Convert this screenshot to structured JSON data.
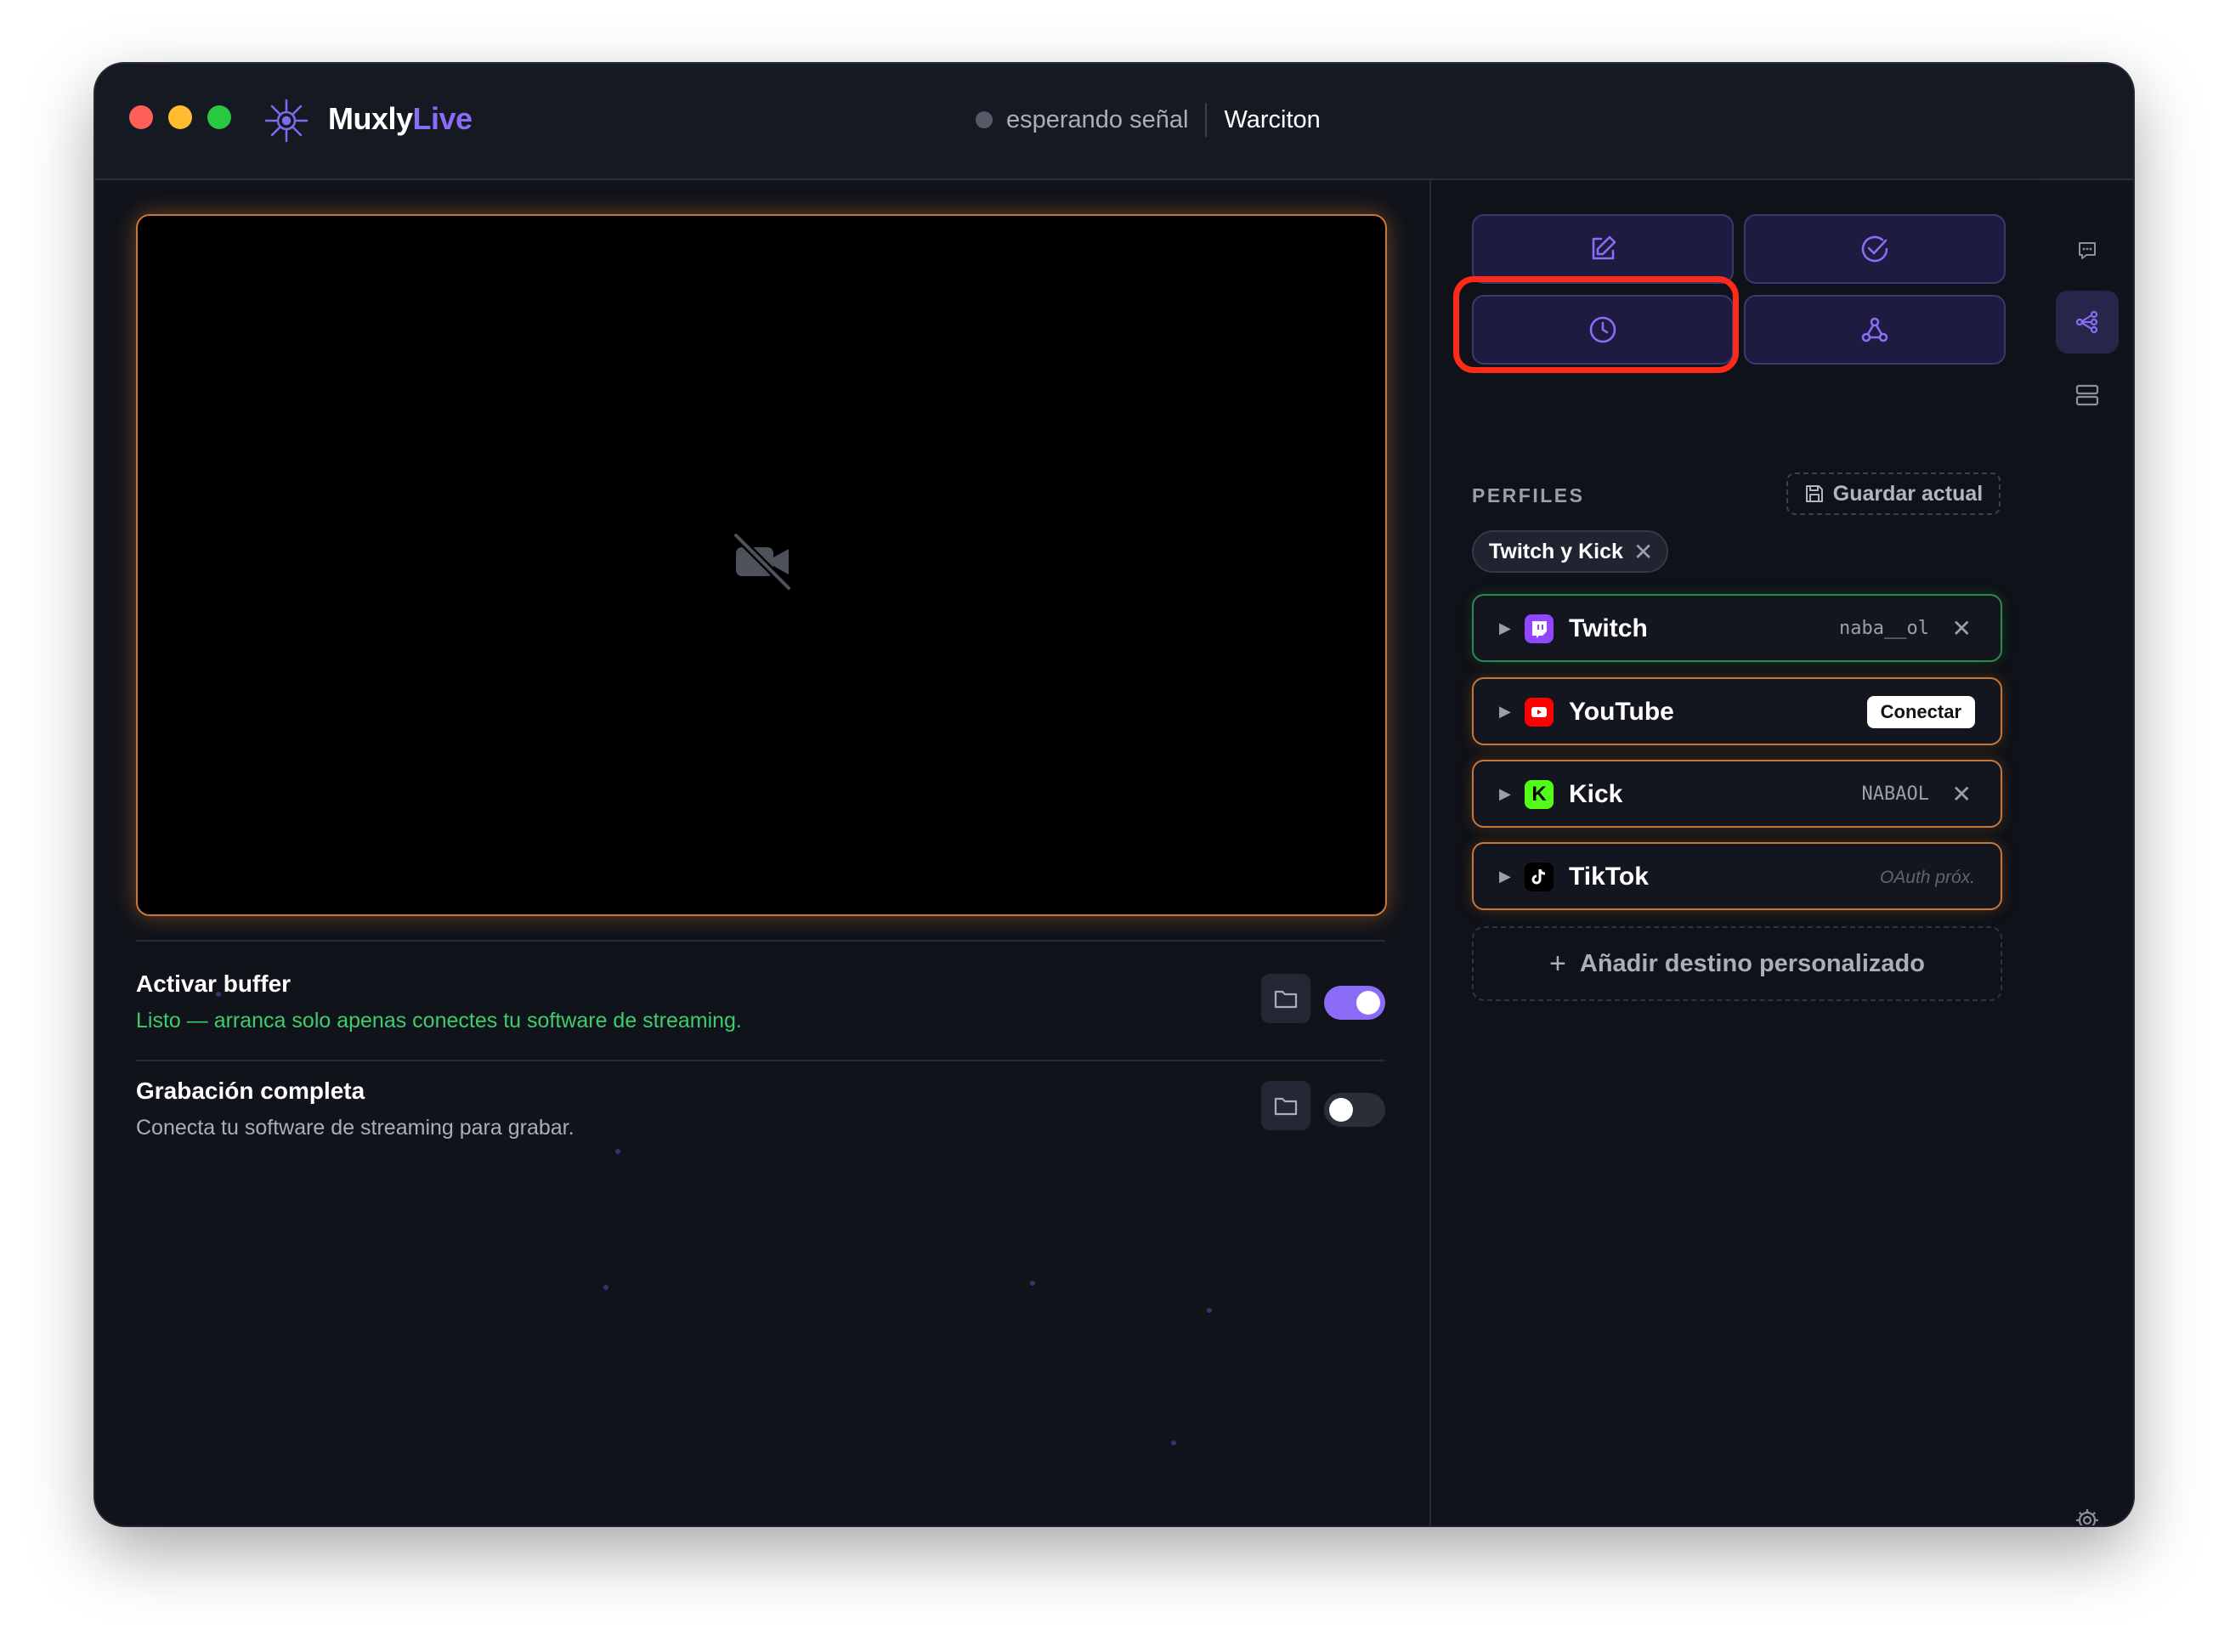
{
  "app": {
    "name_part1": "Muxly",
    "name_part2": "Live"
  },
  "header": {
    "status_text": "esperando señal",
    "channel_name": "Warciton"
  },
  "preview": {
    "state": "no-video",
    "icon": "video-off-icon"
  },
  "buffer": {
    "title": "Activar buffer",
    "subtitle": "Listo — arranca solo apenas conectes tu software de streaming.",
    "enabled": true
  },
  "recording": {
    "title": "Grabación completa",
    "subtitle": "Conecta tu software de streaming para grabar.",
    "enabled": false
  },
  "toolbar": {
    "buttons": [
      {
        "icon": "edit-icon"
      },
      {
        "icon": "check-circle-icon"
      },
      {
        "icon": "clock-icon",
        "highlighted": true
      },
      {
        "icon": "webhook-icon"
      }
    ]
  },
  "profiles": {
    "label": "PERFILES",
    "save_label": "Guardar actual",
    "active_profile": "Twitch y Kick"
  },
  "destinations": [
    {
      "name": "Twitch",
      "account": "naba__ol",
      "state": "connected"
    },
    {
      "name": "YouTube",
      "action": "Conectar",
      "state": "disconnected"
    },
    {
      "name": "Kick",
      "account": "NABAOL",
      "state": "connected"
    },
    {
      "name": "TikTok",
      "note": "OAuth próx.",
      "state": "unavailable"
    }
  ],
  "add_destination": "Añadir destino personalizado",
  "colors": {
    "accent": "#8b6cf6",
    "warning_border": "#c7763a",
    "success": "#3dcc6e",
    "highlight": "#ff2a1a",
    "twitch": "#9146ff",
    "youtube": "#ff0000",
    "kick": "#53fc18"
  },
  "sidebar": {
    "items": [
      {
        "icon": "chat-icon",
        "active": false
      },
      {
        "icon": "share-nodes-icon",
        "active": true
      },
      {
        "icon": "server-icon",
        "active": false
      },
      {
        "icon": "gear-icon",
        "active": false
      }
    ]
  }
}
